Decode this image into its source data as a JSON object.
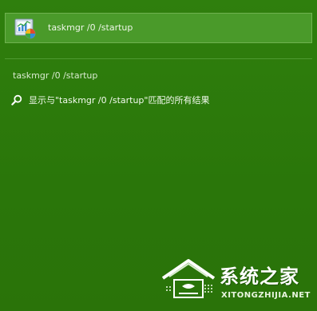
{
  "top_result": {
    "icon": "task-manager-program-icon",
    "label": "taskmgr /0 /startup"
  },
  "search_section": {
    "query_label": "taskmgr /0 /startup",
    "show_matches": {
      "icon": "search-icon",
      "label": "显示与\"taskmgr /0 /startup\"匹配的所有结果"
    }
  },
  "watermark": {
    "title": "系统之家",
    "url": "XITONGZHIJIA.NET"
  },
  "colors": {
    "background": "#2c7a0a",
    "selected_item": "#4a9a2a",
    "text": "#f3faef"
  }
}
